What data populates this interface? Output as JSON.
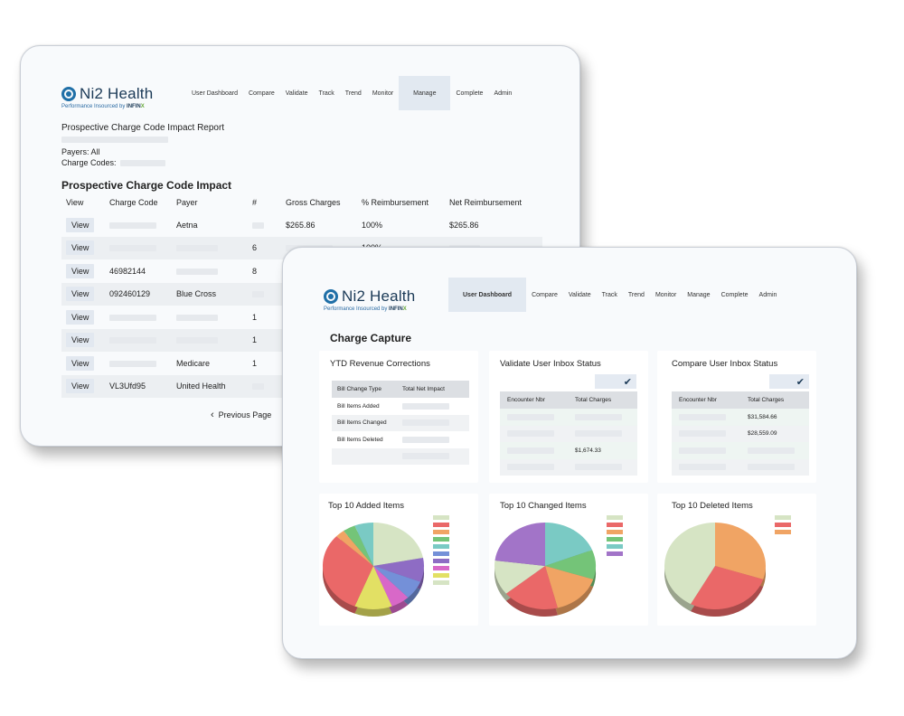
{
  "back": {
    "logo": {
      "name": "Ni2 Health",
      "tagline": "Performance Insourced by",
      "brand": "INFIN",
      "brand_x": "X"
    },
    "nav": [
      {
        "label": "User Dashboard",
        "active": false
      },
      {
        "label": "Compare",
        "active": false
      },
      {
        "label": "Validate",
        "active": false
      },
      {
        "label": "Track",
        "active": false
      },
      {
        "label": "Trend",
        "active": false
      },
      {
        "label": "Monitor",
        "active": false
      },
      {
        "label": "Manage",
        "active": true
      },
      {
        "label": "Complete",
        "active": false
      },
      {
        "label": "Admin",
        "active": false
      }
    ],
    "report_title": "Prospective Charge Code Impact Report",
    "payers_label": "Payers: All",
    "charge_codes_label": "Charge Codes:",
    "heading": "Prospective Charge Code Impact",
    "columns": [
      "View",
      "Charge Code",
      "Payer",
      "#",
      "Gross Charges",
      "% Reimbursement",
      "Net Reimbursement"
    ],
    "rows": [
      {
        "view": "View",
        "code": "",
        "payer": "Aetna",
        "count": "",
        "gross": "$265.86",
        "pct": "100%",
        "net": "$265.86"
      },
      {
        "view": "View",
        "code": "",
        "payer": "",
        "count": "6",
        "gross": "",
        "pct": "100%",
        "net": ""
      },
      {
        "view": "View",
        "code": "46982144",
        "payer": "",
        "count": "8",
        "gross": "",
        "pct": "",
        "net": ""
      },
      {
        "view": "View",
        "code": "092460129",
        "payer": "Blue Cross",
        "count": "",
        "gross": "",
        "pct": "",
        "net": ""
      },
      {
        "view": "View",
        "code": "",
        "payer": "",
        "count": "1",
        "gross": "",
        "pct": "",
        "net": ""
      },
      {
        "view": "View",
        "code": "",
        "payer": "",
        "count": "1",
        "gross": "",
        "pct": "",
        "net": ""
      },
      {
        "view": "View",
        "code": "",
        "payer": "Medicare",
        "count": "1",
        "gross": "",
        "pct": "",
        "net": ""
      },
      {
        "view": "View",
        "code": "VL3Ufd95",
        "payer": "United Health",
        "count": "",
        "gross": "",
        "pct": "",
        "net": ""
      }
    ],
    "prev_label": "Previous Page"
  },
  "front": {
    "logo": {
      "name": "Ni2 Health",
      "tagline": "Performance Insourced by",
      "brand": "INFIN",
      "brand_x": "X"
    },
    "nav": [
      {
        "label": "User Dashboard",
        "active": true
      },
      {
        "label": "Compare",
        "active": false
      },
      {
        "label": "Validate",
        "active": false
      },
      {
        "label": "Track",
        "active": false
      },
      {
        "label": "Trend",
        "active": false
      },
      {
        "label": "Monitor",
        "active": false
      },
      {
        "label": "Manage",
        "active": false
      },
      {
        "label": "Complete",
        "active": false
      },
      {
        "label": "Admin",
        "active": false
      }
    ],
    "title": "Charge Capture",
    "ytd": {
      "title": "YTD Revenue Corrections",
      "columns": [
        "Bill Change Type",
        "Total Net Impact"
      ],
      "rows": [
        "Bill Items Added",
        "Bill Items Changed",
        "Bill Items Deleted",
        ""
      ]
    },
    "validate": {
      "title": "Validate User Inbox Status",
      "check": "✔",
      "columns": [
        "Encounter Nbr",
        "Total Charges"
      ],
      "rows": [
        "",
        "",
        "$1,674.33",
        ""
      ]
    },
    "compare": {
      "title": "Compare User Inbox Status",
      "check": "✔",
      "columns": [
        "Encounter Nbr",
        "Total Charges"
      ],
      "rows": [
        "$31,584.66",
        "$28,559.09",
        "",
        ""
      ]
    },
    "pies": [
      {
        "title": "Top 10 Added Items",
        "slices": [
          22,
          9,
          7,
          6,
          12,
          31,
          3,
          4,
          6
        ],
        "colors": [
          "#d6e4c4",
          "#8e6cc4",
          "#7490d8",
          "#d868c8",
          "#e2e064",
          "#ea6868",
          "#f0a464",
          "#74c478",
          "#7acac4"
        ]
      },
      {
        "title": "Top 10 Changed Items",
        "slices": [
          19,
          11,
          16,
          18,
          13,
          23
        ],
        "colors": [
          "#7acac4",
          "#74c478",
          "#f0a464",
          "#ea6868",
          "#d6e4c4",
          "#a274c8"
        ]
      },
      {
        "title": "Top 10 Deleted Items",
        "slices": [
          30,
          28,
          42
        ],
        "colors": [
          "#f0a464",
          "#ea6868",
          "#d6e4c4"
        ]
      }
    ],
    "legend_colors": [
      [
        "#d6e4c4",
        "#ea6868",
        "#f0a464",
        "#74c478",
        "#7acac4",
        "#7490d8",
        "#8e6cc4",
        "#d868c8",
        "#e2e064",
        "#d6e4c4"
      ],
      [
        "#d6e4c4",
        "#ea6868",
        "#f0a464",
        "#74c478",
        "#7acac4",
        "#a274c8"
      ],
      [
        "#d6e4c4",
        "#ea6868",
        "#f0a464"
      ]
    ]
  }
}
